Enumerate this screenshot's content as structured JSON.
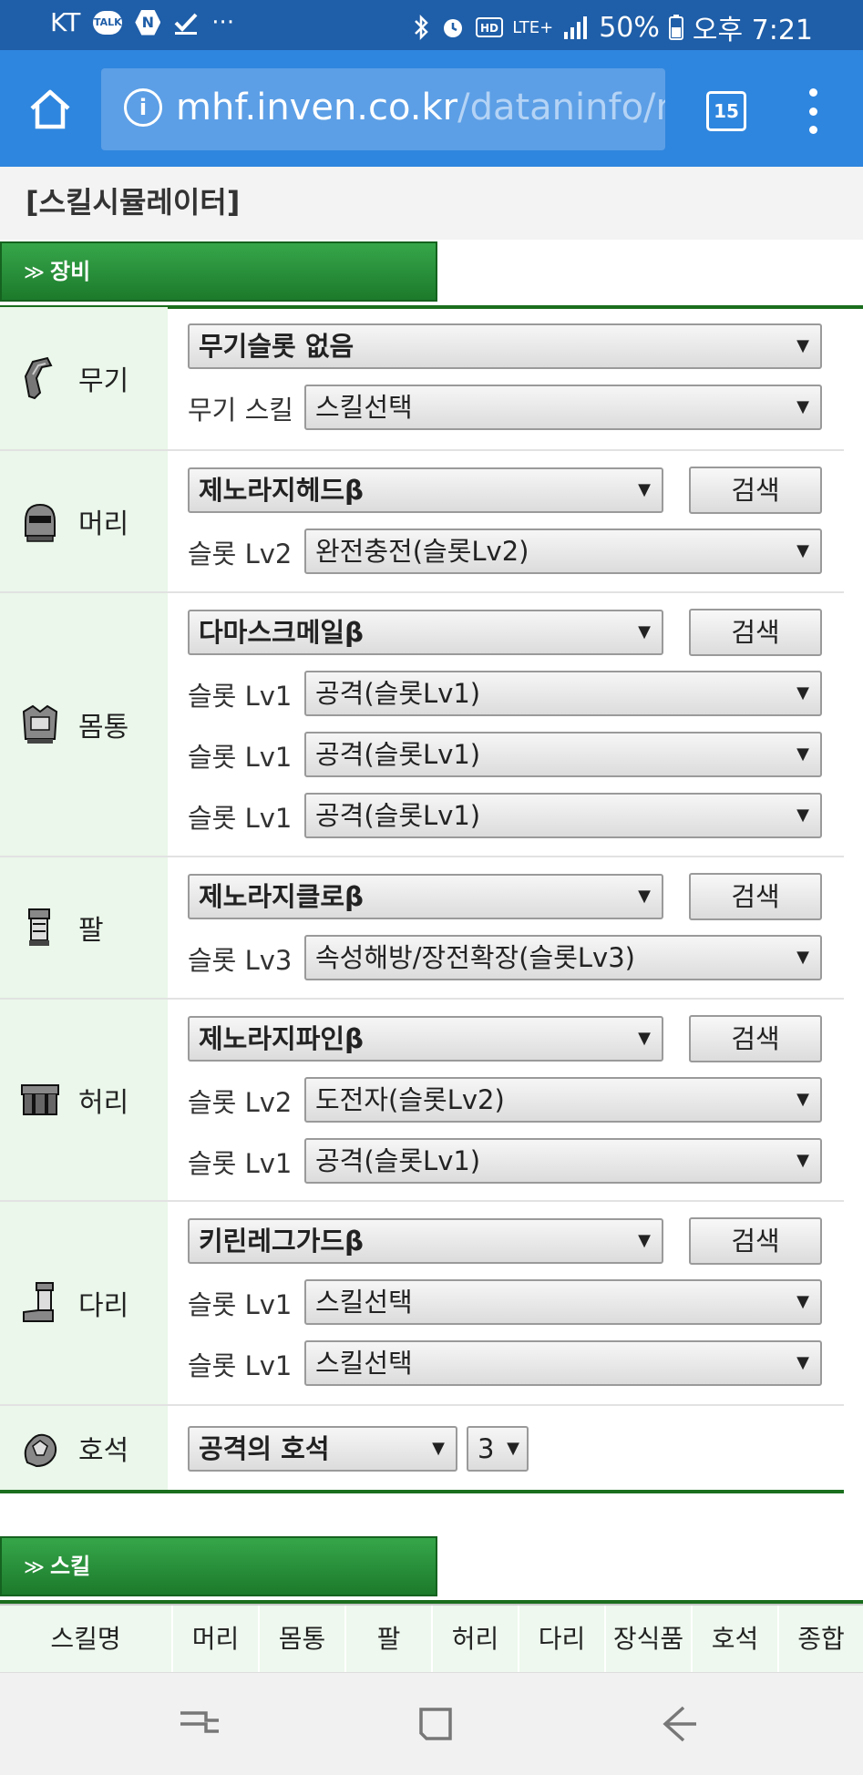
{
  "status_bar": {
    "carrier": "KT",
    "talk_badge": "TALK",
    "n_badge": "N",
    "more": "···",
    "lte": "LTE+",
    "battery": "50%",
    "time": "오후 7:21"
  },
  "browser": {
    "url_host": "mhf.inven.co.kr",
    "url_path": "/dataninfo/ml",
    "tab_count": "15"
  },
  "page": {
    "title": "[스킬시뮬레이터]"
  },
  "equip_section": {
    "header": "장비"
  },
  "equip": {
    "weapon": {
      "label": "무기",
      "main_select": "무기슬롯 없음",
      "skill_label": "무기 스킬",
      "skill_select": "스킬선택"
    },
    "head": {
      "label": "머리",
      "main_select": "제노라지헤드β",
      "search": "검색",
      "slots": [
        {
          "label": "슬롯 Lv2",
          "value": "완전충전(슬롯Lv2)"
        }
      ]
    },
    "body": {
      "label": "몸통",
      "main_select": "다마스크메일β",
      "search": "검색",
      "slots": [
        {
          "label": "슬롯 Lv1",
          "value": "공격(슬롯Lv1)"
        },
        {
          "label": "슬롯 Lv1",
          "value": "공격(슬롯Lv1)"
        },
        {
          "label": "슬롯 Lv1",
          "value": "공격(슬롯Lv1)"
        }
      ]
    },
    "arm": {
      "label": "팔",
      "main_select": "제노라지클로β",
      "search": "검색",
      "slots": [
        {
          "label": "슬롯 Lv3",
          "value": "속성해방/장전확장(슬롯Lv3)"
        }
      ]
    },
    "waist": {
      "label": "허리",
      "main_select": "제노라지파인β",
      "search": "검색",
      "slots": [
        {
          "label": "슬롯 Lv2",
          "value": "도전자(슬롯Lv2)"
        },
        {
          "label": "슬롯 Lv1",
          "value": "공격(슬롯Lv1)"
        }
      ]
    },
    "leg": {
      "label": "다리",
      "main_select": "키린레그가드β",
      "search": "검색",
      "slots": [
        {
          "label": "슬롯 Lv1",
          "value": "스킬선택"
        },
        {
          "label": "슬롯 Lv1",
          "value": "스킬선택"
        }
      ]
    },
    "gem": {
      "label": "호석",
      "main_select": "공격의 호석",
      "count_select": "3"
    }
  },
  "select_arrow": "▼",
  "skill_section": {
    "header": "스킬",
    "columns": [
      "스킬명",
      "머리",
      "몸통",
      "팔",
      "허리",
      "다리",
      "장식품",
      "호석",
      "종합"
    ]
  }
}
